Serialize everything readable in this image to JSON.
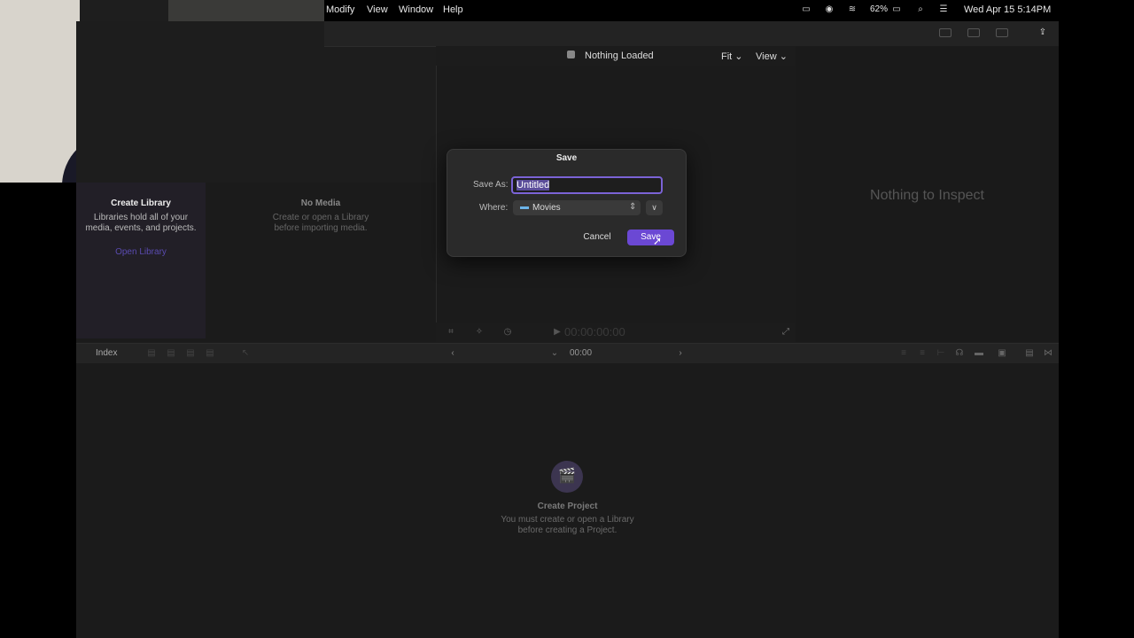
{
  "menu": {
    "items": [
      "Modify",
      "View",
      "Window",
      "Help"
    ],
    "battery": "62%",
    "clock": "Wed Apr 15  5:14PM"
  },
  "viewer": {
    "title": "Nothing Loaded",
    "fit_label": "Fit",
    "view_label": "View",
    "timecode": "00:00:00:00"
  },
  "browser": {
    "create_library": {
      "title": "Create Library",
      "body_line1": "Libraries hold all of your",
      "body_line2": "media, events, and projects.",
      "link": "Open Library"
    },
    "no_media": {
      "title": "No Media",
      "body_line1": "Create or open a Library",
      "body_line2": "before importing media."
    }
  },
  "inspector": {
    "empty_text": "Nothing to Inspect"
  },
  "timeline": {
    "index_label": "Index",
    "timecode": "00:00",
    "create_project": {
      "title": "Create Project",
      "body_line1": "You must create or open a Library",
      "body_line2": "before creating a Project."
    }
  },
  "dialog": {
    "title": "Save",
    "save_as_label": "Save As:",
    "save_as_value": "Untitled",
    "where_label": "Where:",
    "where_value": "Movies",
    "cancel_label": "Cancel",
    "save_label": "Save"
  },
  "colors": {
    "accent": "#6b48d4",
    "link": "#5a4bb0",
    "background": "#1b1b1b"
  }
}
